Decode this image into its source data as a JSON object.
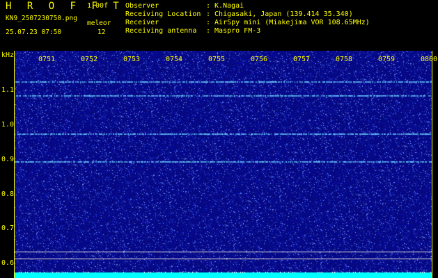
{
  "header": {
    "title": "H R O F F T",
    "version": "1.00f",
    "filename": "KN9_2507230750.png",
    "datetime": "25.07.23 07:50",
    "meleor_label": "meleor",
    "meleor_count": "12"
  },
  "info": [
    {
      "label": "Observer",
      "value": ": K.Nagai"
    },
    {
      "label": "Receiving Location",
      "value": ": Chigasaki, Japan (139.414 35.340)"
    },
    {
      "label": "Receiver",
      "value": ": AirSpy mini (Miakejima VOR 108.65MHz)"
    },
    {
      "label": "Receiving antenna",
      "value": ": Maspro FM-3"
    }
  ],
  "axis": {
    "unit": "kHz",
    "y_ticks": [
      "1.1",
      "1.0",
      "0.9",
      "0.8",
      "0.7",
      "0.6"
    ],
    "x_ticks": [
      "0751",
      "0752",
      "0753",
      "0754",
      "0755",
      "0756",
      "0757",
      "0758",
      "0759",
      "0800"
    ]
  },
  "colors": {
    "background": "#000000",
    "text": "#ffff00",
    "noise_base": "#0a0a8c",
    "line": "#66ccff",
    "bottom_band": "#00ffff"
  },
  "spectrogram": {
    "frequency_lines_khz": [
      1.11,
      1.07,
      0.96,
      0.88
    ],
    "marker_lines_khz": [
      0.62,
      0.6
    ]
  }
}
